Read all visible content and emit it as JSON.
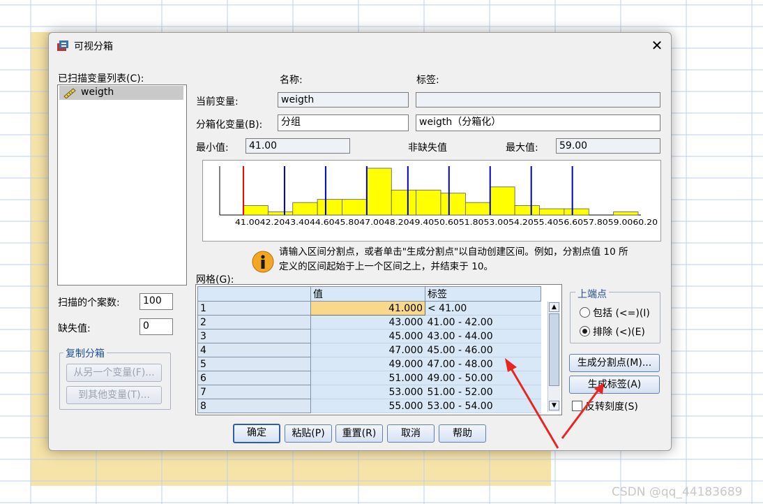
{
  "dialog": {
    "title": "可视分箱",
    "scanned_list_label": "已扫描变量列表(C):",
    "scanned_variables": [
      "weigth"
    ],
    "col_name": "名称:",
    "col_label": "标签:",
    "current_var_label": "当前变量:",
    "current_var_name": "weigth",
    "current_var_tag": "",
    "binned_var_label": "分箱化变量(B):",
    "binned_var_name": "分组",
    "binned_var_tag": "weigth（分箱化）",
    "min_label": "最小值:",
    "min_value": "41.00",
    "nonmissing_label": "非缺失值",
    "max_label": "最大值:",
    "max_value": "59.00",
    "info_text_1": "请输入区间分割点，或者单击\"生成分割点\"以自动创建区间。例如，分割点值 10 所",
    "info_text_2": "定义的区间起始于上一个区间之上，并结束于 10。",
    "cases_label": "扫描的个案数:",
    "cases_value": "100",
    "missing_label": "缺失值:",
    "missing_value": "0",
    "copy_group": "复制分箱",
    "copy_from": "从另一个变量(F)...",
    "copy_to": "到其他变量(T)...",
    "grid_label": "网格(G):",
    "grid_col_value": "值",
    "grid_col_label": "标签",
    "grid_rows": [
      {
        "n": "1",
        "value": "41.000",
        "label": "< 41.00"
      },
      {
        "n": "2",
        "value": "43.000",
        "label": "41.00 - 42.00"
      },
      {
        "n": "3",
        "value": "45.000",
        "label": "43.00 - 44.00"
      },
      {
        "n": "4",
        "value": "47.000",
        "label": "45.00 - 46.00"
      },
      {
        "n": "5",
        "value": "49.000",
        "label": "47.00 - 48.00"
      },
      {
        "n": "6",
        "value": "51.000",
        "label": "49.00 - 50.00"
      },
      {
        "n": "7",
        "value": "53.000",
        "label": "51.00 - 52.00"
      },
      {
        "n": "8",
        "value": "55.000",
        "label": "53.00 - 54.00"
      }
    ],
    "upper_group": "上端点",
    "include_label": "包括 (<=)(I)",
    "exclude_label": "排除 (<)(E)",
    "make_cutpoints": "生成分割点(M)...",
    "make_labels": "生成标签(A)",
    "reverse_scale": "反转刻度(S)",
    "btn_ok": "确定",
    "btn_paste": "粘贴(P)",
    "btn_reset": "重置(R)",
    "btn_cancel": "取消",
    "btn_help": "帮助"
  },
  "chart_data": {
    "type": "bar",
    "x_ticks": [
      "41.00",
      "42.20",
      "43.40",
      "44.60",
      "45.80",
      "47.00",
      "48.20",
      "49.40",
      "50.60",
      "51.80",
      "53.00",
      "54.20",
      "55.40",
      "56.60",
      "57.80",
      "59.00",
      "60.20"
    ],
    "bin_width": 1.2,
    "xlim": [
      41.0,
      60.2
    ],
    "counts": [
      3,
      1,
      4,
      5,
      5,
      15,
      8,
      8,
      7,
      4,
      9,
      3,
      2,
      2,
      0,
      1
    ],
    "cutpoints": [
      41,
      43,
      45,
      47,
      49,
      51,
      53,
      55,
      57
    ],
    "colors": {
      "bars": "#ffff00",
      "first_cutpoint": "#ff0000",
      "cutpoints": "#0000cc"
    }
  },
  "watermark": "CSDN @qq_44183689",
  "colors": {
    "selected_cell": "#f8d98b",
    "grid_cell": "#d8e8f7",
    "arrow": "#e8251e"
  }
}
